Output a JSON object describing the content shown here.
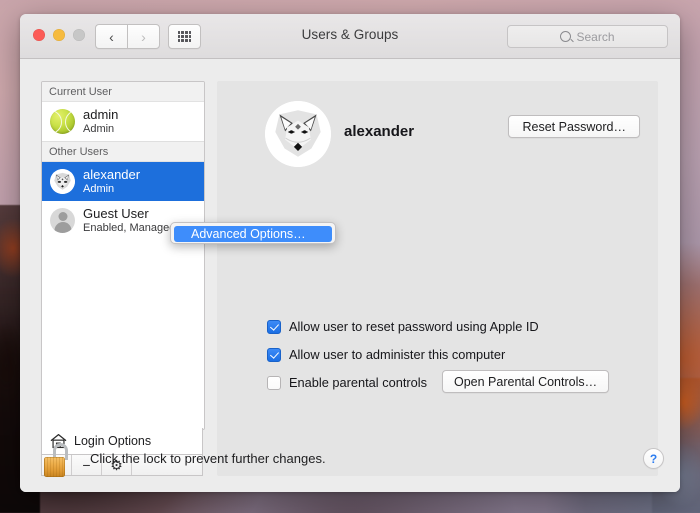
{
  "window": {
    "title": "Users & Groups",
    "traffic_lights": [
      "close",
      "minimize",
      "zoom"
    ],
    "nav": {
      "back": "‹",
      "forward": "›",
      "grid": "grid-icon"
    },
    "search": {
      "placeholder": "Search",
      "value": ""
    }
  },
  "sidebar": {
    "groups": [
      {
        "header": "Current User",
        "users": [
          {
            "name": "admin",
            "role": "Admin",
            "avatar": "tennis-ball",
            "selected": false
          }
        ]
      },
      {
        "header": "Other Users",
        "users": [
          {
            "name": "alexander",
            "role": "Admin",
            "avatar": "fox",
            "selected": true
          },
          {
            "name": "Guest User",
            "role": "Enabled, Managed",
            "avatar": "silhouette",
            "selected": false
          }
        ]
      }
    ],
    "login_options": {
      "label": "Login Options",
      "icon": "house-icon"
    },
    "actions": [
      {
        "name": "add-user",
        "glyph": "+"
      },
      {
        "name": "remove-user",
        "glyph": "−"
      },
      {
        "name": "settings",
        "glyph": "⚙"
      }
    ]
  },
  "main": {
    "user_name": "alexander",
    "avatar": "fox",
    "reset_password_label": "Reset Password…",
    "options": [
      {
        "label": "Allow user to reset password using Apple ID",
        "checked": true
      },
      {
        "label": "Allow user to administer this computer",
        "checked": true
      },
      {
        "label": "Enable parental controls",
        "checked": false
      }
    ],
    "parental_controls_label": "Open Parental Controls…"
  },
  "context_menu": {
    "items": [
      {
        "label": "Advanced Options…",
        "highlighted": true
      }
    ]
  },
  "footer": {
    "lock_state": "unlocked",
    "lock_message": "Click the lock to prevent further changes.",
    "help_label": "?"
  },
  "colors": {
    "selection_blue": "#1d6fdc",
    "menu_highlight_blue": "#3e8dfb",
    "checkbox_blue": "#2a7df5",
    "help_blue": "#2b7cf0",
    "lock_gold": "#dd9730",
    "window_bg": "#ececec",
    "panel_bg": "#e4e4e4"
  }
}
